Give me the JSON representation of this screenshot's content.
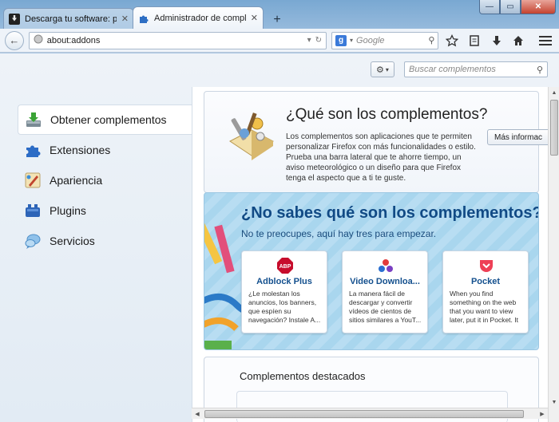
{
  "window": {
    "minimize": "—",
    "maximize": "▭",
    "close": "✕"
  },
  "tabs": [
    {
      "title": "Descarga tu software: prog...",
      "close": "✕"
    },
    {
      "title": "Administrador de comple...",
      "close": "✕"
    }
  ],
  "newtab": "+",
  "navbar": {
    "back": "←",
    "url": "about:addons",
    "search_engine": "g",
    "search_placeholder": "Google",
    "search_go": "⚲",
    "dropdown": "▾",
    "reload": "↻",
    "icons": [
      "bookmark-star-icon",
      "bookmarks-list-icon",
      "download-icon",
      "home-icon",
      "menu-icon"
    ]
  },
  "addons": {
    "gear": "⚙",
    "gear_arrow": "▾",
    "search_placeholder": "Buscar complementos",
    "search_icon": "⚲"
  },
  "categories": [
    {
      "label": "Obtener complementos",
      "icon": "get-addons-icon"
    },
    {
      "label": "Extensiones",
      "icon": "extensions-icon"
    },
    {
      "label": "Apariencia",
      "icon": "appearance-icon"
    },
    {
      "label": "Plugins",
      "icon": "plugins-icon"
    },
    {
      "label": "Servicios",
      "icon": "services-icon"
    }
  ],
  "intro": {
    "title": "¿Qué son los complementos?",
    "body": "Los complementos son aplicaciones que te permiten personalizar Firefox con más funcionalidades o estilo. Prueba una barra lateral que te ahorre tiempo, un aviso meteorológico o un diseño para que Firefox tenga el aspecto que a ti te guste.",
    "more_button": "Más informac"
  },
  "promo": {
    "title": "¿No sabes qué son los complementos?",
    "subtitle": "No te preocupes, aquí hay tres para empezar.",
    "items": [
      {
        "name": "Adblock Plus",
        "desc": "¿Le molestan los anuncios, los banners, que espíen su navegación? Instale A...",
        "icon": "adblock-plus-icon",
        "badge": "ABP"
      },
      {
        "name": "Video Downloa...",
        "desc": "La manera fácil de descargar y convertir vídeos de cientos de sitios similares a YouT...",
        "icon": "video-downloadhelper-icon"
      },
      {
        "name": "Pocket",
        "desc": "When you find something on the web that you want to view later, put it in Pocket. It automaticall...",
        "icon": "pocket-icon"
      }
    ]
  },
  "featured": {
    "title": "Complementos destacados"
  },
  "scroll": {
    "up": "▲",
    "down": "▼",
    "left": "◀",
    "right": "▶"
  }
}
